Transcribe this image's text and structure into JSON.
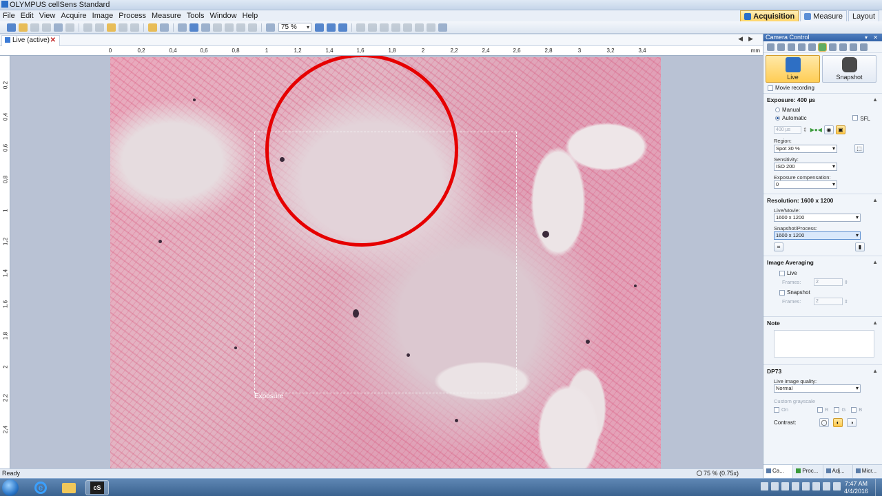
{
  "window": {
    "title": "OLYMPUS cellSens Standard"
  },
  "menu": [
    "File",
    "Edit",
    "View",
    "Acquire",
    "Image",
    "Process",
    "Measure",
    "Tools",
    "Window",
    "Help"
  ],
  "layouts": {
    "acquisition": "Acquisition",
    "measure": "Measure",
    "layout": "Layout"
  },
  "toolbar": {
    "zoom": "75 %"
  },
  "document": {
    "tab_label": "Live (active)"
  },
  "ruler": {
    "unit": "mm",
    "h_ticks": [
      "0",
      "0,2",
      "0,4",
      "0,6",
      "0,8",
      "1",
      "1,2",
      "1,4",
      "1,6",
      "1,8",
      "2",
      "2,2",
      "2,4",
      "2,6",
      "2,8",
      "3",
      "3,2",
      "3,4"
    ],
    "v_ticks": [
      "0,2",
      "0,4",
      "0,6",
      "0,8",
      "1",
      "1,2",
      "1,4",
      "1,6",
      "1,8",
      "2",
      "2,2",
      "2,4"
    ]
  },
  "image": {
    "selection_label": "Exposure",
    "annotation_color": "#e60000"
  },
  "statusbar": {
    "status": "Ready",
    "zoom": "75 % (0.75x)"
  },
  "panel": {
    "title": "Camera Control",
    "live_label": "Live",
    "snapshot_label": "Snapshot",
    "movie_recording": "Movie recording",
    "exposure": {
      "title": "Exposure: 400 µs",
      "manual": "Manual",
      "automatic": "Automatic",
      "sfl": "SFL",
      "time_value": "400 µs",
      "region_label": "Region:",
      "region_value": "Spot 30 %",
      "sensitivity_label": "Sensitivity:",
      "sensitivity_value": "ISO 200",
      "compensation_label": "Exposure compensation:",
      "compensation_value": "0"
    },
    "resolution": {
      "title": "Resolution: 1600 x 1200",
      "live_label": "Live/Movie:",
      "live_value": "1600 x 1200",
      "snapshot_label": "Snapshot/Process:",
      "snapshot_value": "1600 x 1200"
    },
    "averaging": {
      "title": "Image Averaging",
      "live_label": "Live",
      "frames_label": "Frames:",
      "live_frames": "2",
      "snapshot_label": "Snapshot",
      "snapshot_frames": "2"
    },
    "note": {
      "title": "Note"
    },
    "dp73": {
      "title": "DP73",
      "quality_label": "Live image quality:",
      "quality_value": "Normal",
      "grayscale_label": "Custom grayscale",
      "on": "On",
      "r": "R",
      "g": "G",
      "b": "B",
      "contrast_label": "Contrast:"
    },
    "tabs": [
      "Ca...",
      "Proc...",
      "Adj...",
      "Micr..."
    ]
  },
  "taskbar": {
    "time": "7:47 AM",
    "date": "4/4/2016",
    "app_label": "cS"
  }
}
